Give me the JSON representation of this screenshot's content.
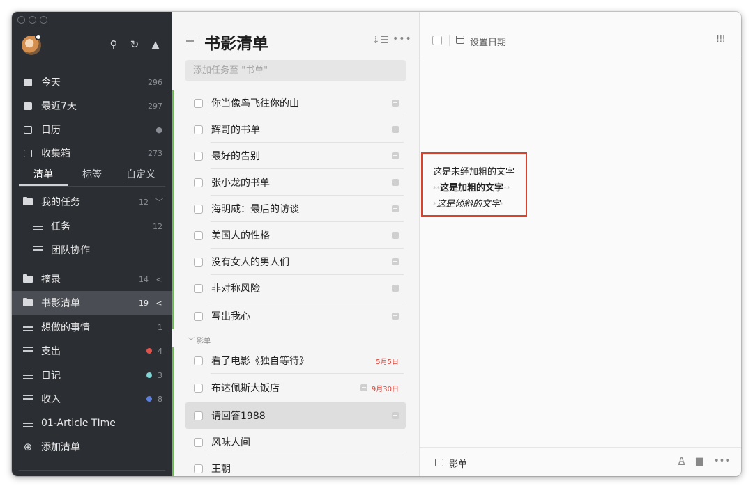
{
  "sidebar": {
    "smart_lists": [
      {
        "label": "今天",
        "count": "296",
        "icon": "calendar-day-icon"
      },
      {
        "label": "最近7天",
        "count": "297",
        "icon": "calendar-week-icon"
      },
      {
        "label": "日历",
        "count": "",
        "icon": "calendar-grid-icon"
      },
      {
        "label": "收集箱",
        "count": "273",
        "icon": "inbox-icon"
      }
    ],
    "tabs": [
      "清单",
      "标签",
      "自定义"
    ],
    "lists": [
      {
        "label": "我的任务",
        "count": "12",
        "chev": "﹀",
        "icon": "folder-icon"
      },
      {
        "label": "任务",
        "count": "12",
        "chev": "",
        "icon": "list-icon"
      },
      {
        "label": "团队协作",
        "count": "",
        "chev": "",
        "icon": "list-icon"
      },
      {
        "label": "摘录",
        "count": "14",
        "chev": "<",
        "icon": "folder-icon"
      },
      {
        "label": "书影清单",
        "count": "19",
        "chev": "<",
        "icon": "folder-icon"
      },
      {
        "label": "想做的事情",
        "count": "1",
        "chev": "",
        "icon": "list-icon"
      },
      {
        "label": "支出",
        "count": "4",
        "chev": "",
        "icon": "list-icon",
        "dot": "#e0534a"
      },
      {
        "label": "日记",
        "count": "3",
        "chev": "",
        "icon": "list-icon",
        "dot": "#7fd6d6"
      },
      {
        "label": "收入",
        "count": "8",
        "chev": "",
        "icon": "list-icon",
        "dot": "#5b7fe0"
      },
      {
        "label": "01-Article TIme",
        "count": "",
        "chev": "",
        "icon": "list-filter-icon"
      },
      {
        "label": "添加清单",
        "count": "",
        "chev": "",
        "icon": "plus-circle-icon"
      }
    ]
  },
  "list": {
    "title": "书影清单",
    "add_placeholder": "添加任务至 \"书单\"",
    "books": [
      "你当像鸟飞往你的山",
      "辉哥的书单",
      "最好的告别",
      "张小龙的书单",
      "海明威：最后的访谈",
      "美国人的性格",
      "没有女人的男人们",
      "非对称风险",
      "写出我心"
    ],
    "section": "﹀ 影单",
    "movies": [
      {
        "label": "看了电影《独自等待》",
        "date": "5月5日",
        "note": false
      },
      {
        "label": "布达佩斯大饭店",
        "date": "9月30日",
        "note": true
      },
      {
        "label": "请回答1988",
        "date": "",
        "note": true
      },
      {
        "label": "风味人间",
        "date": "",
        "note": false
      },
      {
        "label": "王朝",
        "date": "",
        "note": false
      }
    ]
  },
  "detail": {
    "set_date": "设置日期",
    "priority": "!!!",
    "content": {
      "line1": "这是未经加粗的文字",
      "line2": "这是加粗的文字",
      "line2_marks": "**",
      "line3": "这是倾斜的文字",
      "line3_marks": "*"
    },
    "project": "影单"
  }
}
